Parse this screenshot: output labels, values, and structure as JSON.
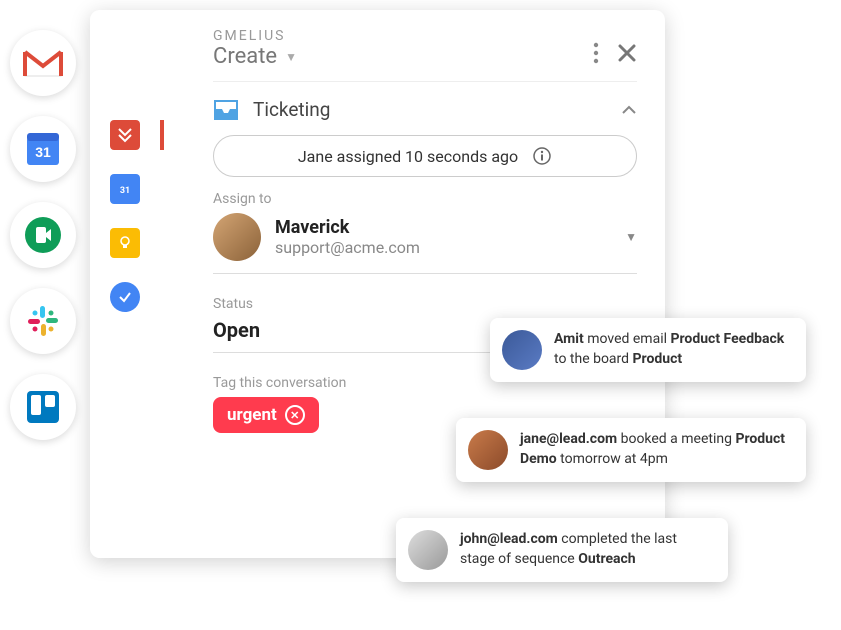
{
  "header": {
    "brand": "GMELIUS",
    "create_label": "Create"
  },
  "section": {
    "title": "Ticketing"
  },
  "pill": {
    "text": "Jane assigned 10 seconds ago"
  },
  "assignee": {
    "label": "Assign to",
    "name": "Maverick",
    "email": "support@acme.com"
  },
  "status": {
    "label": "Status",
    "value": "Open"
  },
  "tag": {
    "label": "Tag this conversation",
    "chip": "urgent"
  },
  "toasts": {
    "t1": {
      "pre": "",
      "b1": "Amit",
      "mid1": " moved email ",
      "b2": "Product Feedback",
      "mid2": " to the board ",
      "b3": "Product"
    },
    "t2": {
      "b1": "jane@lead.com",
      "mid1": " booked a meeting ",
      "b2": "Product Demo",
      "mid2": " tomorrow at 4pm"
    },
    "t3": {
      "b1": "john@lead.com",
      "mid1": " completed the last stage of sequence ",
      "b2": "Outreach"
    }
  },
  "colors": {
    "urgent": "#ff3b4e",
    "brand_red": "#dd4b39"
  }
}
